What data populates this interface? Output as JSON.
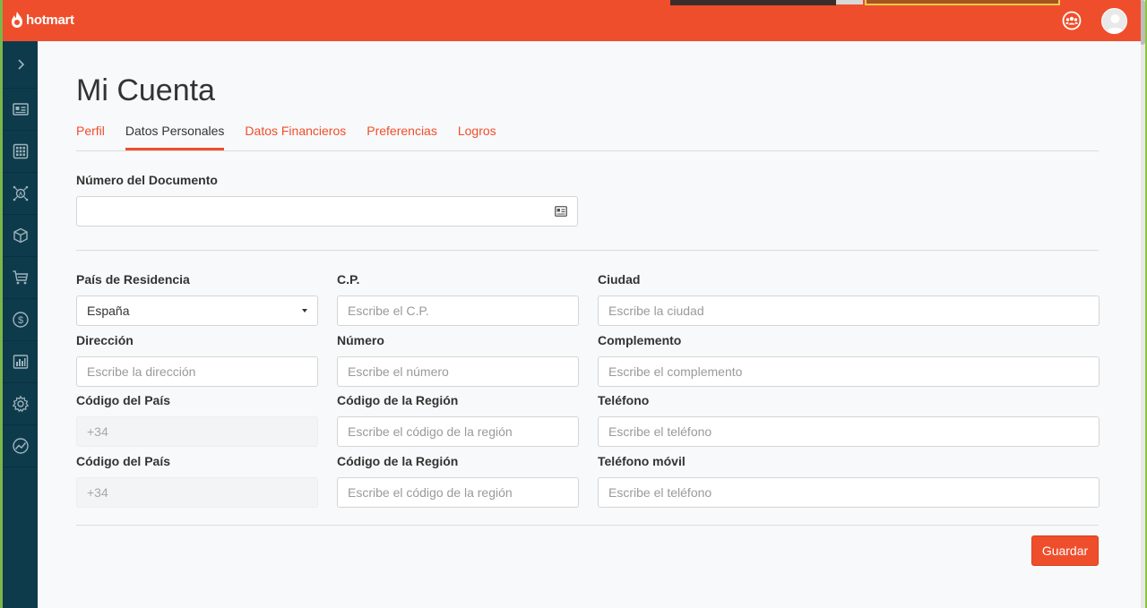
{
  "brand": {
    "name": "hotmart",
    "color": "#ef4e2c",
    "sidebar_color": "#0d3b4c"
  },
  "topbar": {
    "icons": [
      "community-icon",
      "user-avatar"
    ]
  },
  "sidebar": {
    "items": [
      "chevron-right-icon",
      "dashboard-icon",
      "apps-grid-icon",
      "affiliates-network-icon",
      "product-box-icon",
      "cart-icon",
      "dollar-coin-icon",
      "bar-chart-icon",
      "gear-icon",
      "analytics-trend-icon"
    ]
  },
  "page": {
    "title": "Mi Cuenta"
  },
  "tabs": [
    {
      "label": "Perfil",
      "active": false
    },
    {
      "label": "Datos Personales",
      "active": true
    },
    {
      "label": "Datos Financieros",
      "active": false
    },
    {
      "label": "Preferencias",
      "active": false
    },
    {
      "label": "Logros",
      "active": false
    }
  ],
  "document": {
    "label": "Número del Documento",
    "value": ""
  },
  "form": {
    "pais": {
      "label": "País de Residencia",
      "value": "España"
    },
    "cp": {
      "label": "C.P.",
      "placeholder": "Escribe el C.P."
    },
    "ciudad": {
      "label": "Ciudad",
      "placeholder": "Escribe la ciudad"
    },
    "direccion": {
      "label": "Dirección",
      "placeholder": "Escribe la dirección"
    },
    "numero": {
      "label": "Número",
      "placeholder": "Escribe el número"
    },
    "complemento": {
      "label": "Complemento",
      "placeholder": "Escribe el complemento"
    },
    "codigo_pais_1": {
      "label": "Código del País",
      "value": "+34"
    },
    "codigo_region_1": {
      "label": "Código de la Región",
      "placeholder": "Escribe el código de la región"
    },
    "telefono": {
      "label": "Teléfono",
      "placeholder": "Escribe el teléfono"
    },
    "codigo_pais_2": {
      "label": "Código del País",
      "value": "+34"
    },
    "codigo_region_2": {
      "label": "Código de la Región",
      "placeholder": "Escribe el código de la región"
    },
    "telefono_movil": {
      "label": "Teléfono móvil",
      "placeholder": "Escribe el teléfono"
    }
  },
  "actions": {
    "save_label": "Guardar"
  }
}
